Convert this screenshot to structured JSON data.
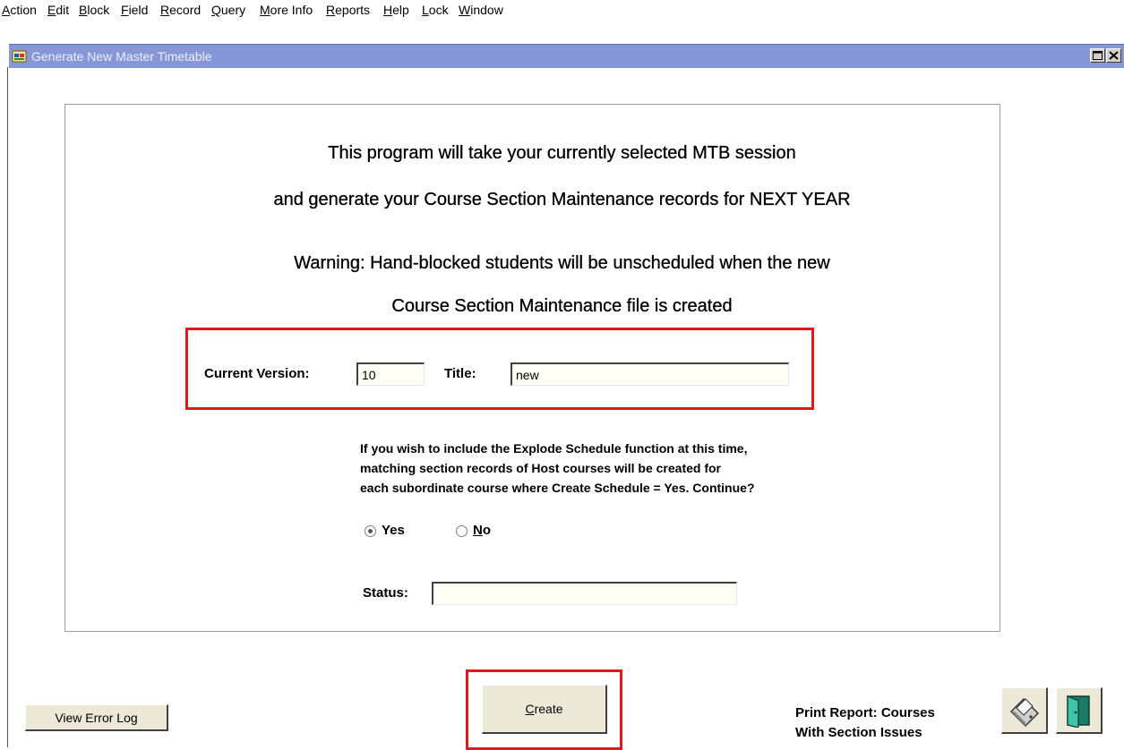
{
  "menubar": {
    "items": [
      {
        "label": "Action",
        "underline": "A",
        "rest": "ction"
      },
      {
        "label": "Edit",
        "underline": "E",
        "rest": "dit"
      },
      {
        "label": "Block",
        "underline": "B",
        "rest": "lock"
      },
      {
        "label": "Field",
        "underline": "F",
        "rest": "ield"
      },
      {
        "label": "Record",
        "underline": "R",
        "rest": "ecord"
      },
      {
        "label": "Query",
        "underline": "Q",
        "rest": "uery"
      },
      {
        "label": "More Info",
        "underline": "M",
        "rest": "ore Info"
      },
      {
        "label": "Reports",
        "underline": "R",
        "rest": "eports"
      },
      {
        "label": "Help",
        "underline": "H",
        "rest": "elp"
      },
      {
        "label": "Lock",
        "underline": "L",
        "rest": "ock"
      },
      {
        "label": "Window",
        "underline": "W",
        "rest": "indow"
      }
    ]
  },
  "window": {
    "title": "Generate New Master Timetable",
    "title_color": "#8597d6"
  },
  "intro": {
    "line1": "This program will take your currently selected MTB session",
    "line2": "and generate your Course Section Maintenance records for NEXT YEAR",
    "warning1": "Warning: Hand-blocked students will be unscheduled when the new",
    "warning2": "Course Section Maintenance file is created"
  },
  "version": {
    "label": "Current Version:",
    "value": "10",
    "title_label": "Title:",
    "title_value": "new"
  },
  "explode": {
    "line1": "If you wish to include the Explode Schedule function at this time,",
    "line2": "matching section records of Host courses will be created for",
    "line3": "each subordinate course where Create Schedule = Yes.  Continue?",
    "yes_label": "Yes",
    "no_rest": "o",
    "no_underline": "N",
    "selected": "Yes"
  },
  "status": {
    "label": "Status:",
    "value": ""
  },
  "buttons": {
    "view_error_log": "View Error Log",
    "create_underline": "C",
    "create_rest": "reate"
  },
  "print_report": {
    "line1": "Print Report: Courses",
    "line2": "With Section Issues"
  },
  "colors": {
    "highlight": "#e0181e",
    "titlebar": "#8597d6"
  },
  "icons": [
    "app-icon",
    "maximize-icon",
    "close-icon",
    "printer-icon",
    "exit-door-icon"
  ]
}
